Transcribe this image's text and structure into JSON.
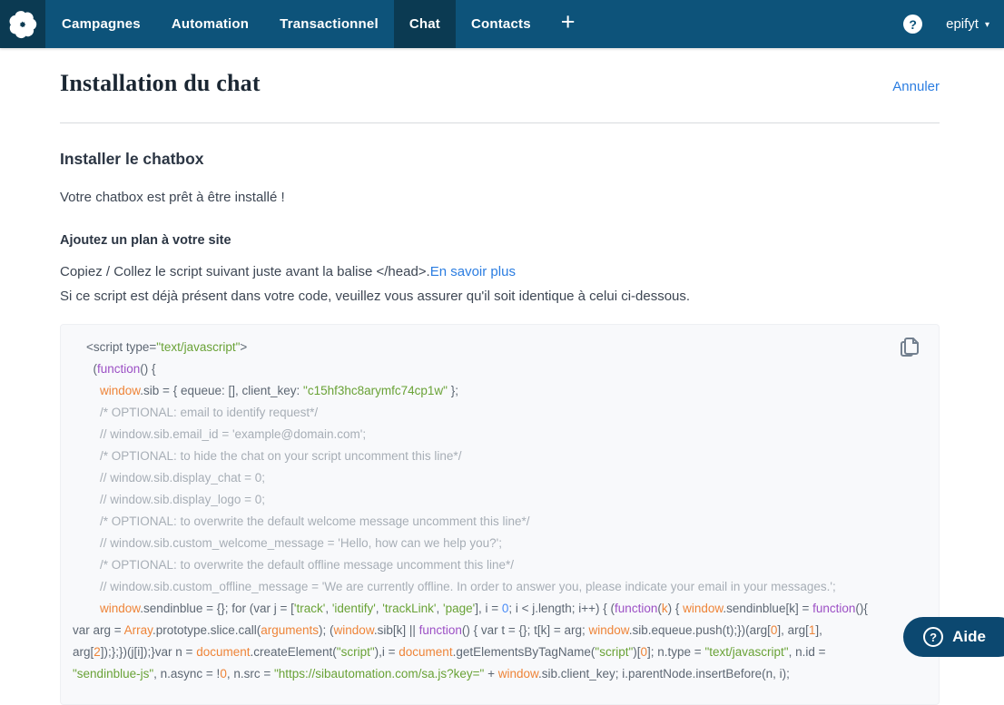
{
  "nav": {
    "items": [
      {
        "label": "Campagnes",
        "active": false
      },
      {
        "label": "Automation",
        "active": false
      },
      {
        "label": "Transactionnel",
        "active": false
      },
      {
        "label": "Chat",
        "active": true
      },
      {
        "label": "Contacts",
        "active": false
      }
    ],
    "add_label": "+",
    "help_label": "?",
    "account_label": "epifyt",
    "caret": "▾"
  },
  "page": {
    "title": "Installation du chat",
    "cancel_label": "Annuler",
    "section_heading": "Installer le chatbox",
    "ready_text": "Votre chatbox est prêt à être installé !",
    "step_heading": "Ajoutez un plan à votre site",
    "instruction_line1": "Copiez / Collez le script suivant juste avant la balise </head>.",
    "learn_more_label": "En savoir plus",
    "instruction_line2": "Si ce script est déjà présent dans votre code, veuillez vous assurer qu'il soit identique à celui ci-dessous."
  },
  "code": {
    "lines": [
      [
        {
          "t": "    <script type=",
          "c": "b"
        },
        {
          "t": "\"text/javascript\"",
          "c": "s"
        },
        {
          "t": ">",
          "c": "b"
        }
      ],
      [
        {
          "t": "      (",
          "c": "b"
        },
        {
          "t": "function",
          "c": "p"
        },
        {
          "t": "() {",
          "c": "b"
        }
      ],
      [
        {
          "t": "        ",
          "c": "b"
        },
        {
          "t": "window",
          "c": "o"
        },
        {
          "t": ".sib = { equeue: [], client_key: ",
          "c": "b"
        },
        {
          "t": "\"c15hf3hc8arymfc74cp1w\"",
          "c": "s"
        },
        {
          "t": " };",
          "c": "b"
        }
      ],
      [
        {
          "t": "        /* OPTIONAL: email to identify request*/",
          "c": "c"
        }
      ],
      [
        {
          "t": "        // window.sib.email_id = 'example@domain.com';",
          "c": "c"
        }
      ],
      [
        {
          "t": "        /* OPTIONAL: to hide the chat on your script uncomment this line*/",
          "c": "c"
        }
      ],
      [
        {
          "t": "        // window.sib.display_chat = 0;",
          "c": "c"
        }
      ],
      [
        {
          "t": "        // window.sib.display_logo = 0;",
          "c": "c"
        }
      ],
      [
        {
          "t": "        /* OPTIONAL: to overwrite the default welcome message uncomment this line*/",
          "c": "c"
        }
      ],
      [
        {
          "t": "        // window.sib.custom_welcome_message = 'Hello, how can we help you?';",
          "c": "c"
        }
      ],
      [
        {
          "t": "        /* OPTIONAL: to overwrite the default offline message uncomment this line*/",
          "c": "c"
        }
      ],
      [
        {
          "t": "        // window.sib.custom_offline_message = 'We are currently offline. In order to answer you, please indicate your email in your messages.';",
          "c": "c"
        }
      ],
      [
        {
          "t": "        ",
          "c": "b"
        },
        {
          "t": "window",
          "c": "o"
        },
        {
          "t": ".sendinblue = {}; for (var j = [",
          "c": "b"
        },
        {
          "t": "'track'",
          "c": "s"
        },
        {
          "t": ", ",
          "c": "b"
        },
        {
          "t": "'identify'",
          "c": "s"
        },
        {
          "t": ", ",
          "c": "b"
        },
        {
          "t": "'trackLink'",
          "c": "s"
        },
        {
          "t": ", ",
          "c": "b"
        },
        {
          "t": "'page'",
          "c": "s"
        },
        {
          "t": "], i = ",
          "c": "b"
        },
        {
          "t": "0",
          "c": "n"
        },
        {
          "t": "; i < j.length; i++) { (",
          "c": "b"
        },
        {
          "t": "function",
          "c": "p"
        },
        {
          "t": "(",
          "c": "b"
        },
        {
          "t": "k",
          "c": "o"
        },
        {
          "t": ") { ",
          "c": "b"
        },
        {
          "t": "window",
          "c": "o"
        },
        {
          "t": ".sendinblue[k] = ",
          "c": "b"
        },
        {
          "t": "function",
          "c": "p"
        },
        {
          "t": "(){",
          "c": "b"
        }
      ],
      [
        {
          "t": "var arg = ",
          "c": "b"
        },
        {
          "t": "Array",
          "c": "o"
        },
        {
          "t": ".prototype.slice.call(",
          "c": "b"
        },
        {
          "t": "arguments",
          "c": "o"
        },
        {
          "t": "); (",
          "c": "b"
        },
        {
          "t": "window",
          "c": "o"
        },
        {
          "t": ".sib[k] || ",
          "c": "b"
        },
        {
          "t": "function",
          "c": "p"
        },
        {
          "t": "() { var t = {}; t[k] = arg; ",
          "c": "b"
        },
        {
          "t": "window",
          "c": "o"
        },
        {
          "t": ".sib.equeue.push(t);})(arg[",
          "c": "b"
        },
        {
          "t": "0",
          "c": "o"
        },
        {
          "t": "], arg[",
          "c": "b"
        },
        {
          "t": "1",
          "c": "o"
        },
        {
          "t": "],",
          "c": "b"
        }
      ],
      [
        {
          "t": "arg[",
          "c": "b"
        },
        {
          "t": "2",
          "c": "o"
        },
        {
          "t": "]);};})(j[i]);}var n = ",
          "c": "b"
        },
        {
          "t": "document",
          "c": "o"
        },
        {
          "t": ".createElement(",
          "c": "b"
        },
        {
          "t": "\"script\"",
          "c": "s"
        },
        {
          "t": "),i = ",
          "c": "b"
        },
        {
          "t": "document",
          "c": "o"
        },
        {
          "t": ".getElementsByTagName(",
          "c": "b"
        },
        {
          "t": "\"script\"",
          "c": "s"
        },
        {
          "t": ")[",
          "c": "b"
        },
        {
          "t": "0",
          "c": "o"
        },
        {
          "t": "]; n.type = ",
          "c": "b"
        },
        {
          "t": "\"text/javascript\"",
          "c": "s"
        },
        {
          "t": ", n.id =",
          "c": "b"
        }
      ],
      [
        {
          "t": "\"sendinblue-js\"",
          "c": "s"
        },
        {
          "t": ", n.async = !",
          "c": "b"
        },
        {
          "t": "0",
          "c": "o"
        },
        {
          "t": ", n.src = ",
          "c": "b"
        },
        {
          "t": "\"https://sibautomation.com/sa.js?key=\"",
          "c": "s"
        },
        {
          "t": " + ",
          "c": "b"
        },
        {
          "t": "window",
          "c": "o"
        },
        {
          "t": ".sib.client_key; i.parentNode.insertBefore(n, i);",
          "c": "b"
        }
      ]
    ]
  },
  "help_button": {
    "label": "Aide",
    "icon": "?"
  },
  "colors": {
    "navbar": "#0d537a",
    "navbar_active": "#0b3a52",
    "link": "#2b7de1",
    "help_button_bg": "#0c4870",
    "code_background": "#f8f9fb"
  }
}
